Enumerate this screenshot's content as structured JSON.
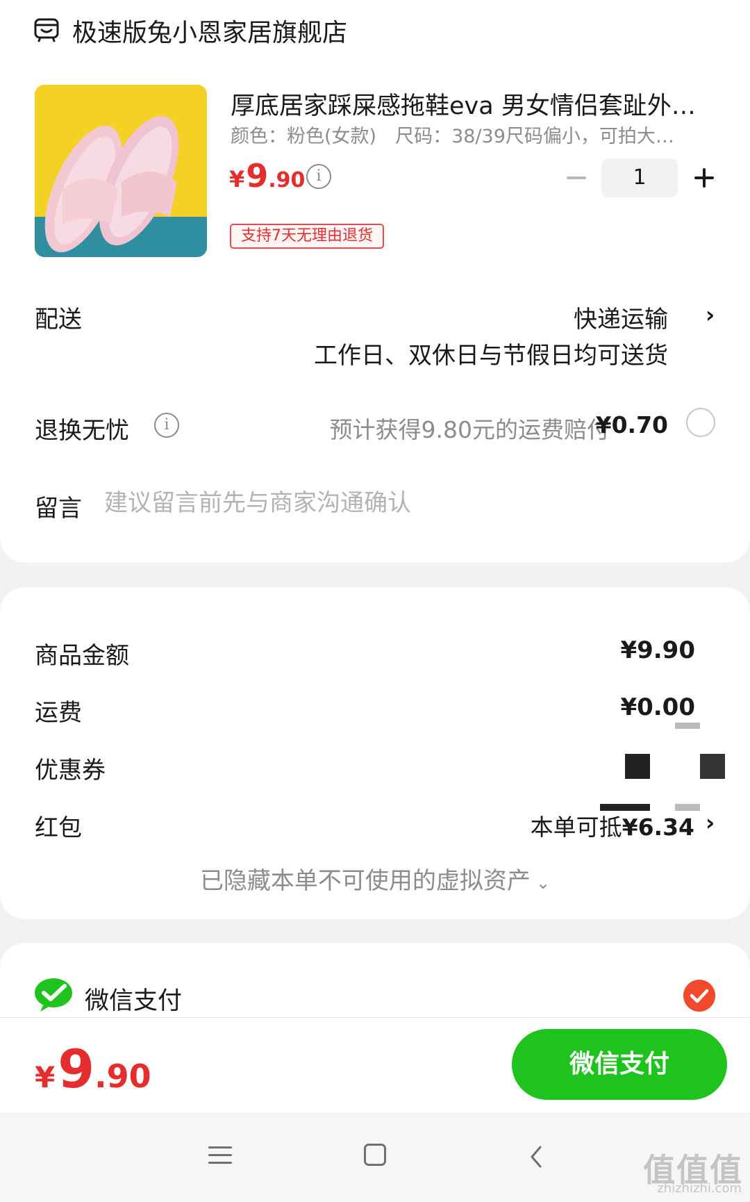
{
  "store": {
    "icon": "store-icon",
    "name": "极速版兔小恩家居旗舰店"
  },
  "product": {
    "title": "厚底居家踩屎感拖鞋eva 男女情侣套趾外…",
    "spec": "颜色：粉色(女款)　尺码：38/39尺码偏小，可拍大…",
    "price_symbol": "¥",
    "price_int": "9",
    "price_dec": ".90",
    "quantity": "1",
    "return_tag": "支持7天无理由退货"
  },
  "delivery": {
    "label": "配送",
    "method": "快递运输",
    "note": "工作日、双休日与节假日均可送货"
  },
  "return_insurance": {
    "label": "退换无忧",
    "desc": "预计获得9.80元的运费赔付",
    "price": "¥0.70",
    "selected": false
  },
  "message": {
    "label": "留言",
    "placeholder": "建议留言前先与商家沟通确认"
  },
  "summary": {
    "goods_label": "商品金额",
    "goods_value": "¥9.90",
    "shipping_label": "运费",
    "shipping_value": "¥0.00",
    "coupon_label": "优惠券",
    "redpack_label": "红包",
    "redpack_prefix": "本单可抵",
    "redpack_value": "¥6.34",
    "hidden_assets": "已隐藏本单不可使用的虚拟资产"
  },
  "payment": {
    "method_label": "微信支付",
    "selected": true
  },
  "bottom": {
    "total_symbol": "¥",
    "total_int": "9",
    "total_dec": ".90",
    "pay_button": "微信支付"
  },
  "watermark": {
    "text": "值值值",
    "sub": "zhizhizhi.com"
  },
  "colors": {
    "price_red": "#e52d2d",
    "wechat_green": "#1ec31e",
    "check_orange": "#f0492d",
    "background": "#f2f2f2"
  }
}
